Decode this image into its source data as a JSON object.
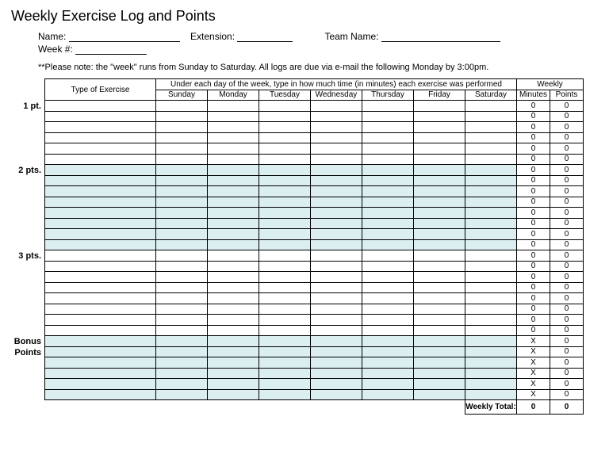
{
  "title": "Weekly Exercise Log and Points",
  "fields": {
    "name_label": "Name:",
    "extension_label": "Extension:",
    "team_label": "Team Name:",
    "week_label": "Week #:"
  },
  "note": "**Please note: the \"week\" runs from Sunday to Saturday.  All logs are due via e-mail the following Monday by 3:00pm.",
  "table": {
    "type_header": "Type of Exercise",
    "days_header": "Under each day of the week, type in how much time (in minutes) each exercise was performed",
    "days": [
      "Sunday",
      "Monday",
      "Tuesday",
      "Wednesday",
      "Thursday",
      "Friday",
      "Saturday"
    ],
    "weekly_header": "Weekly",
    "minutes_header": "Minutes",
    "points_header": "Points",
    "sections": [
      {
        "label": "1 pt.",
        "rows": 6,
        "tinted": false,
        "minutes": "0",
        "points": "0"
      },
      {
        "label": "2 pts.",
        "rows": 8,
        "tinted": true,
        "minutes": "0",
        "points": "0"
      },
      {
        "label": "3 pts.",
        "rows": 8,
        "tinted": false,
        "minutes": "0",
        "points": "0"
      },
      {
        "label": "Bonus Points",
        "rows": 6,
        "tinted": true,
        "minutes": "X",
        "points": "0"
      }
    ],
    "footer_label": "Weekly Total:",
    "footer_minutes": "0",
    "footer_points": "0"
  }
}
